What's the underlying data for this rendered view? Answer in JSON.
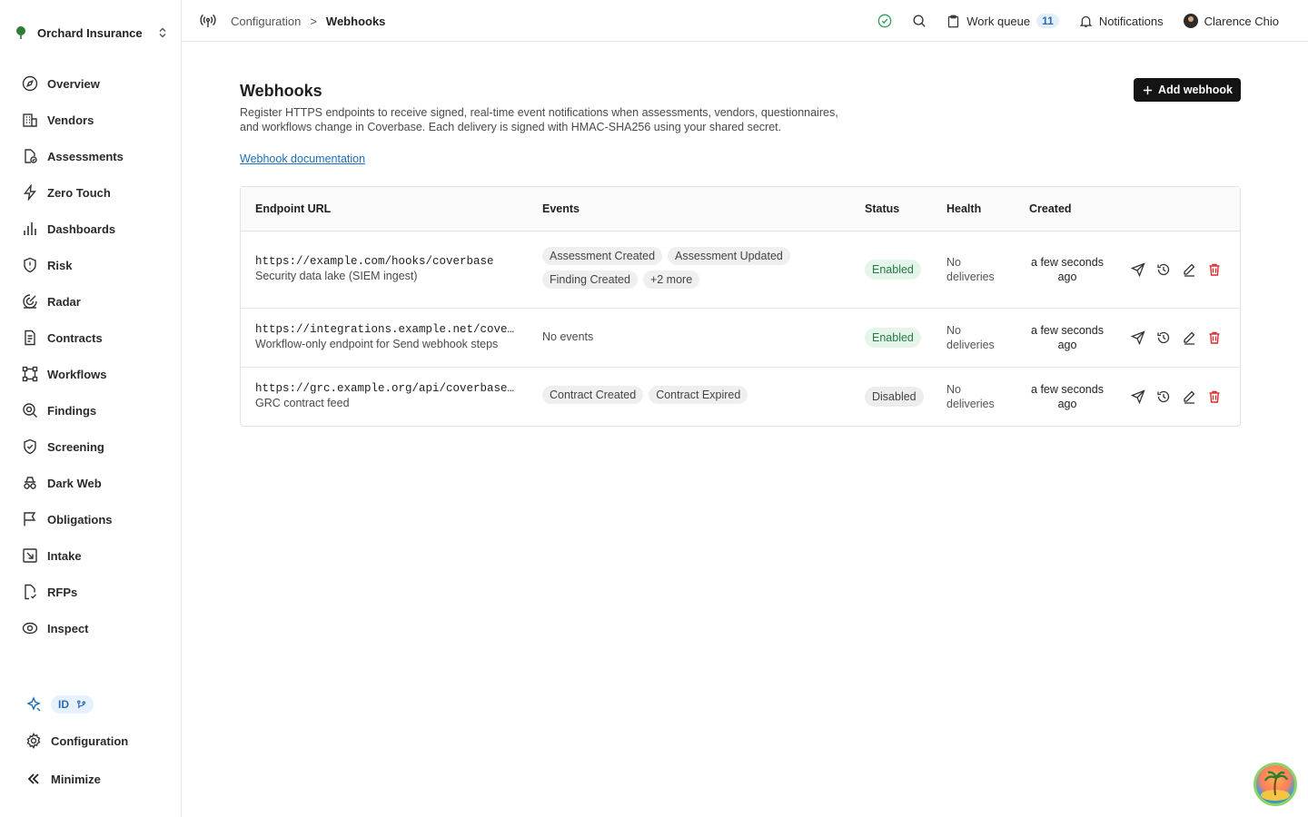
{
  "org": {
    "name": "Orchard Insurance"
  },
  "sidebar": {
    "items": [
      {
        "label": "Overview",
        "icon": "compass-icon"
      },
      {
        "label": "Vendors",
        "icon": "building-icon"
      },
      {
        "label": "Assessments",
        "icon": "file-check-icon"
      },
      {
        "label": "Zero Touch",
        "icon": "bolt-icon"
      },
      {
        "label": "Dashboards",
        "icon": "bar-chart-icon"
      },
      {
        "label": "Risk",
        "icon": "shield-alert-icon"
      },
      {
        "label": "Radar",
        "icon": "radar-icon"
      },
      {
        "label": "Contracts",
        "icon": "document-icon"
      },
      {
        "label": "Workflows",
        "icon": "workflow-icon"
      },
      {
        "label": "Findings",
        "icon": "search-doc-icon"
      },
      {
        "label": "Screening",
        "icon": "shield-check-icon"
      },
      {
        "label": "Dark Web",
        "icon": "incognito-icon"
      },
      {
        "label": "Obligations",
        "icon": "flag-icon"
      },
      {
        "label": "Intake",
        "icon": "intake-icon"
      },
      {
        "label": "RFPs",
        "icon": "file-signature-icon"
      },
      {
        "label": "Inspect",
        "icon": "eye-icon"
      }
    ],
    "id_label": "ID",
    "configuration_label": "Configuration",
    "minimize_label": "Minimize"
  },
  "breadcrumb": {
    "parent": "Configuration",
    "current": "Webhooks",
    "separator": ">"
  },
  "header": {
    "work_queue_label": "Work queue",
    "work_queue_count": "11",
    "notifications_label": "Notifications",
    "user_name": "Clarence Chio"
  },
  "page": {
    "title": "Webhooks",
    "description": "Register HTTPS endpoints to receive signed, real-time event notifications when assessments, vendors, questionnaires, and workflows change in Coverbase. Each delivery is signed with HMAC-SHA256 using your shared secret.",
    "doc_link": "Webhook documentation",
    "add_button": "Add webhook"
  },
  "table": {
    "columns": {
      "url": "Endpoint URL",
      "events": "Events",
      "status": "Status",
      "health": "Health",
      "created": "Created"
    },
    "rows": [
      {
        "url": "https://example.com/hooks/coverbase",
        "description": "Security data lake (SIEM ingest)",
        "events": [
          "Assessment Created",
          "Assessment Updated",
          "Finding Created",
          "+2 more"
        ],
        "status": "Enabled",
        "health": "No deliveries",
        "created": "a few seconds ago"
      },
      {
        "url": "https://integrations.example.net/coverbase/workflow",
        "description": "Workflow-only endpoint for Send webhook steps",
        "events": [],
        "no_events": "No events",
        "status": "Enabled",
        "health": "No deliveries",
        "created": "a few seconds ago"
      },
      {
        "url": "https://grc.example.org/api/coverbase/contracts",
        "description": "GRC contract feed",
        "events": [
          "Contract Created",
          "Contract Expired"
        ],
        "status": "Disabled",
        "health": "No deliveries",
        "created": "a few seconds ago"
      }
    ]
  },
  "colors": {
    "accent": "#1c6fb8",
    "enabled": "#237a45",
    "danger": "#d32f2f",
    "primary_button": "#141414"
  }
}
